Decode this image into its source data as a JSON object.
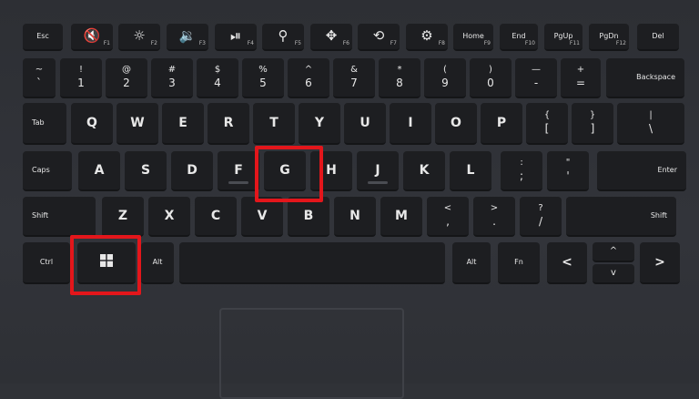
{
  "keyboard": {
    "fn_row": [
      {
        "label": "Esc",
        "type": "text"
      },
      {
        "icon": "mute-icon",
        "glyph": "🔇",
        "fn": "F1"
      },
      {
        "icon": "backlight-icon",
        "glyph": "☼",
        "fn": "F2"
      },
      {
        "icon": "volume-down-icon",
        "glyph": "🔉",
        "fn": "F3"
      },
      {
        "icon": "play-pause-icon",
        "glyph": "⏯",
        "fn": "F4"
      },
      {
        "icon": "search-icon",
        "glyph": "⚲",
        "fn": "F5"
      },
      {
        "icon": "share-icon",
        "glyph": "✥",
        "fn": "F6"
      },
      {
        "icon": "settings-icon",
        "glyph": "⟲",
        "fn": "F7"
      },
      {
        "icon": "gear-icon",
        "glyph": "⚙",
        "fn": "F8"
      },
      {
        "label": "Home",
        "type": "text",
        "fn": "F9"
      },
      {
        "label": "End",
        "type": "text",
        "fn": "F10"
      },
      {
        "label": "PgUp",
        "type": "text",
        "fn": "F11"
      },
      {
        "label": "PgDn",
        "type": "text",
        "fn": "F12"
      },
      {
        "label": "Del",
        "type": "text"
      }
    ],
    "number_row": [
      {
        "top": "~",
        "bot": "`"
      },
      {
        "top": "!",
        "bot": "1"
      },
      {
        "top": "@",
        "bot": "2"
      },
      {
        "top": "#",
        "bot": "3"
      },
      {
        "top": "$",
        "bot": "4"
      },
      {
        "top": "%",
        "bot": "5"
      },
      {
        "top": "^",
        "bot": "6"
      },
      {
        "top": "&",
        "bot": "7"
      },
      {
        "top": "*",
        "bot": "8"
      },
      {
        "top": "(",
        "bot": "9"
      },
      {
        "top": ")",
        "bot": "0"
      },
      {
        "top": "—",
        "bot": "-"
      },
      {
        "top": "+",
        "bot": "="
      },
      {
        "label": "Backspace"
      }
    ],
    "qwerty_row": [
      {
        "label": "Tab"
      },
      {
        "label": "Q"
      },
      {
        "label": "W"
      },
      {
        "label": "E"
      },
      {
        "label": "R"
      },
      {
        "label": "T"
      },
      {
        "label": "Y"
      },
      {
        "label": "U"
      },
      {
        "label": "I"
      },
      {
        "label": "O"
      },
      {
        "label": "P"
      },
      {
        "top": "{",
        "bot": "["
      },
      {
        "top": "}",
        "bot": "]"
      },
      {
        "top": "|",
        "bot": "\\"
      }
    ],
    "home_row": [
      {
        "label": "Caps"
      },
      {
        "label": "A"
      },
      {
        "label": "S"
      },
      {
        "label": "D"
      },
      {
        "label": "F"
      },
      {
        "label": "G"
      },
      {
        "label": "H"
      },
      {
        "label": "J"
      },
      {
        "label": "K"
      },
      {
        "label": "L"
      },
      {
        "top": ":",
        "bot": ";"
      },
      {
        "top": "\"",
        "bot": "'"
      },
      {
        "label": "Enter"
      }
    ],
    "shift_row": [
      {
        "label": "Shift"
      },
      {
        "label": "Z"
      },
      {
        "label": "X"
      },
      {
        "label": "C"
      },
      {
        "label": "V"
      },
      {
        "label": "B"
      },
      {
        "label": "N"
      },
      {
        "label": "M"
      },
      {
        "top": "<",
        "bot": ","
      },
      {
        "top": ">",
        "bot": "."
      },
      {
        "top": "?",
        "bot": "/"
      },
      {
        "label": "Shift"
      }
    ],
    "bottom_row": {
      "ctrl": "Ctrl",
      "alt_left": "Alt",
      "alt_right": "Alt",
      "fn": "Fn",
      "left_arrow": "<",
      "up_arrow": "^",
      "down_arrow": "v",
      "right_arrow": ">"
    }
  },
  "highlight_color": "#e3161b",
  "highlighted_keys": [
    "G",
    "Windows"
  ]
}
